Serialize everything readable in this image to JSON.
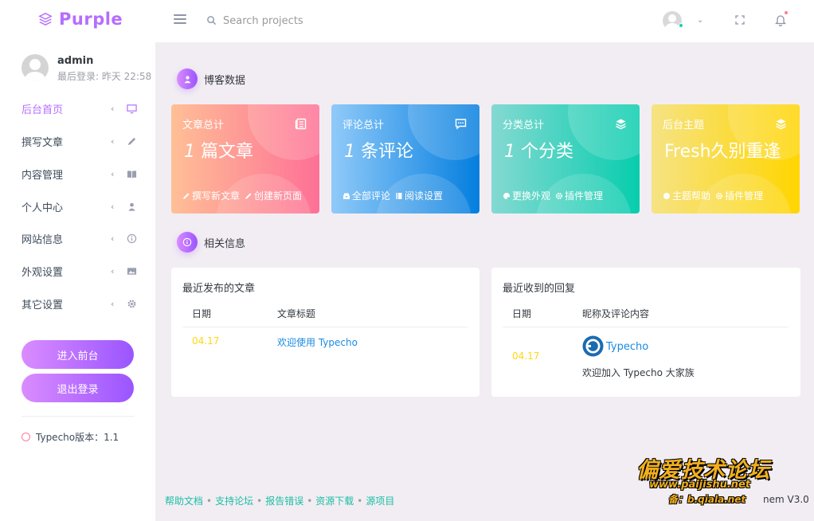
{
  "brand": {
    "name": "Purple"
  },
  "search": {
    "placeholder": "Search projects"
  },
  "sidebar": {
    "username": "admin",
    "last_login": "最后登录: 昨天 22:58",
    "items": [
      {
        "label": "后台首页",
        "icon": "monitor-icon",
        "active": true
      },
      {
        "label": "撰写文章",
        "icon": "pencil-icon"
      },
      {
        "label": "内容管理",
        "icon": "book-icon"
      },
      {
        "label": "个人中心",
        "icon": "user-icon"
      },
      {
        "label": "网站信息",
        "icon": "info-icon"
      },
      {
        "label": "外观设置",
        "icon": "image-icon"
      },
      {
        "label": "其它设置",
        "icon": "gear-icon"
      }
    ],
    "frontend_button": "进入前台",
    "logout_button": "退出登录",
    "version": "Typecho版本：1.1"
  },
  "sections": {
    "blog_data": "博客数据",
    "related_info": "相关信息"
  },
  "cards": [
    {
      "title": "文章总计",
      "number": "1",
      "unit": "篇文章",
      "links": [
        "撰写新文章",
        "创建新页面"
      ],
      "gradient": [
        "#ffbf96",
        "#fe7096"
      ]
    },
    {
      "title": "评论总计",
      "number": "1",
      "unit": "条评论",
      "links": [
        "全部评论",
        "阅读设置"
      ],
      "gradient": [
        "#90caf9",
        "#047edf"
      ]
    },
    {
      "title": "分类总计",
      "number": "1",
      "unit": "个分类",
      "links": [
        "更换外观",
        "插件管理"
      ],
      "gradient": [
        "#84d9d2",
        "#07cdae"
      ]
    },
    {
      "title": "后台主题",
      "big": "Fresh久别重逢",
      "links": [
        "主题帮助",
        "插件管理"
      ],
      "gradient": [
        "#f6e384",
        "#ffd500"
      ]
    }
  ],
  "recent_posts": {
    "title": "最近发布的文章",
    "columns": [
      "日期",
      "文章标题"
    ],
    "rows": [
      {
        "date": "04.17",
        "title": "欢迎使用 Typecho"
      }
    ]
  },
  "recent_replies": {
    "title": "最近收到的回复",
    "columns": [
      "日期",
      "昵称及评论内容"
    ],
    "rows": [
      {
        "date": "04.17",
        "author": "Typecho",
        "content": "欢迎加入 Typecho 大家族"
      }
    ]
  },
  "footer": {
    "links": [
      "帮助文档",
      "支持论坛",
      "报告错误",
      "资源下载",
      "源项目"
    ],
    "theme_credit": "nem V3.0"
  },
  "watermark": {
    "title": "偏爱技术论坛",
    "url": "www.paijishu.net",
    "backup": "备：b.qiala.net"
  },
  "colors": {
    "accent": "#b66dff",
    "footer_link": "#1bbfa4",
    "link": "#198ae3",
    "date": "#fed713"
  }
}
